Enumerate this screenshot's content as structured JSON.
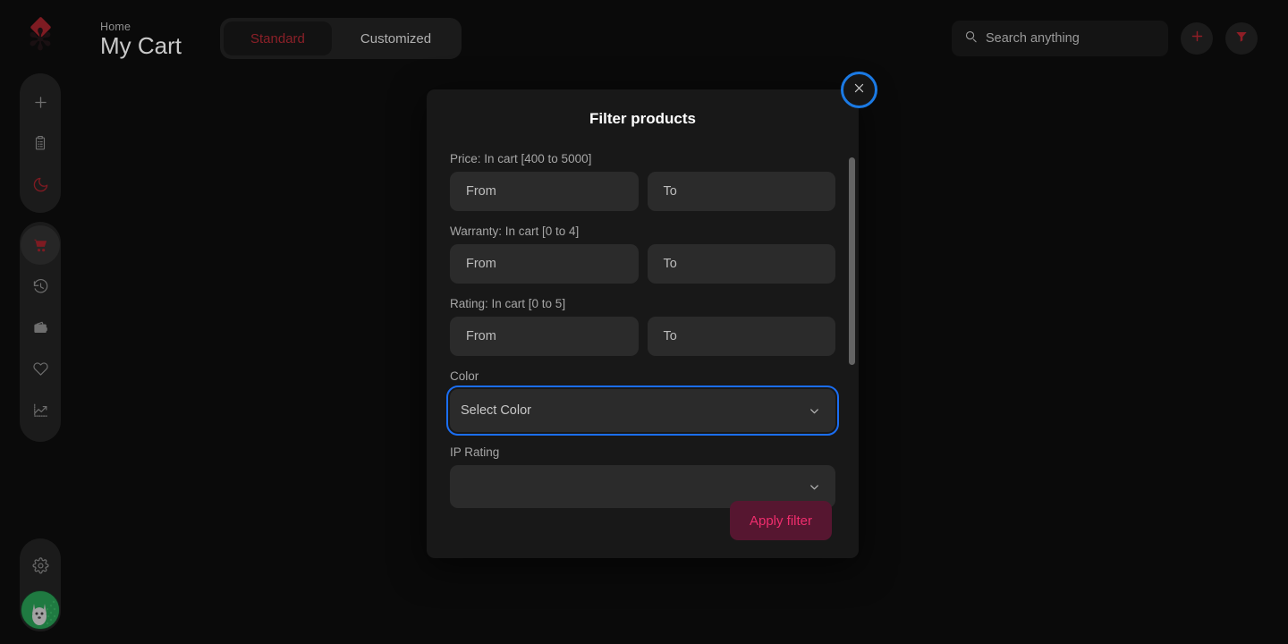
{
  "app": {
    "background_color": "#0a0a0a",
    "accent_color": "#8f1e26",
    "focus_color": "#1b7ae4"
  },
  "sidebar": {
    "logo_name": "brand-logo",
    "top_items": [
      {
        "icon": "plus-icon",
        "label": "Add"
      },
      {
        "icon": "clipboard-list-icon",
        "label": "Lists"
      },
      {
        "icon": "moon-icon",
        "label": "Dark mode"
      }
    ],
    "mid_items": [
      {
        "icon": "shopping-cart-icon",
        "label": "My Cart",
        "active": true
      },
      {
        "icon": "history-clock-icon",
        "label": "History",
        "active": false
      },
      {
        "icon": "wallet-icon",
        "label": "Wallet",
        "active": false
      },
      {
        "icon": "heart-icon",
        "label": "Wishlist",
        "active": false
      },
      {
        "icon": "trending-up-icon",
        "label": "Trends",
        "active": false
      }
    ],
    "bottom_items": [
      {
        "icon": "gear-icon",
        "label": "Settings"
      },
      {
        "icon": "avatar",
        "label": "Profile"
      }
    ]
  },
  "header": {
    "breadcrumb": "Home",
    "title": "My Cart",
    "tabs": [
      {
        "label": "Standard",
        "active": true
      },
      {
        "label": "Customized",
        "active": false
      }
    ],
    "search": {
      "placeholder": "Search anything",
      "value": "",
      "icon": "search-icon"
    },
    "actions": [
      {
        "icon": "plus-icon",
        "label": "Add item"
      },
      {
        "icon": "filter-funnel-icon",
        "label": "Filter"
      }
    ]
  },
  "modal": {
    "title": "Filter products",
    "close_label": "✕",
    "close_icon": "close-icon",
    "fields": [
      {
        "key": "price",
        "label": "Price: In cart [400 to 5000]",
        "type": "range",
        "from_placeholder": "From",
        "to_placeholder": "To",
        "from_value": "",
        "to_value": ""
      },
      {
        "key": "warranty",
        "label": "Warranty: In cart [0 to 4]",
        "type": "range",
        "from_placeholder": "From",
        "to_placeholder": "To",
        "from_value": "",
        "to_value": ""
      },
      {
        "key": "rating",
        "label": "Rating: In cart [0 to 5]",
        "type": "range",
        "from_placeholder": "From",
        "to_placeholder": "To",
        "from_value": "",
        "to_value": ""
      },
      {
        "key": "color",
        "label": "Color",
        "type": "select",
        "selected": "Select Color",
        "focused": true,
        "chevron_icon": "chevron-down-icon"
      },
      {
        "key": "ip_rating",
        "label": "IP Rating",
        "type": "select",
        "selected": "",
        "focused": false,
        "chevron_icon": "chevron-down-icon"
      }
    ],
    "apply_label": "Apply filter",
    "scrollbar": {
      "visible": true
    }
  }
}
